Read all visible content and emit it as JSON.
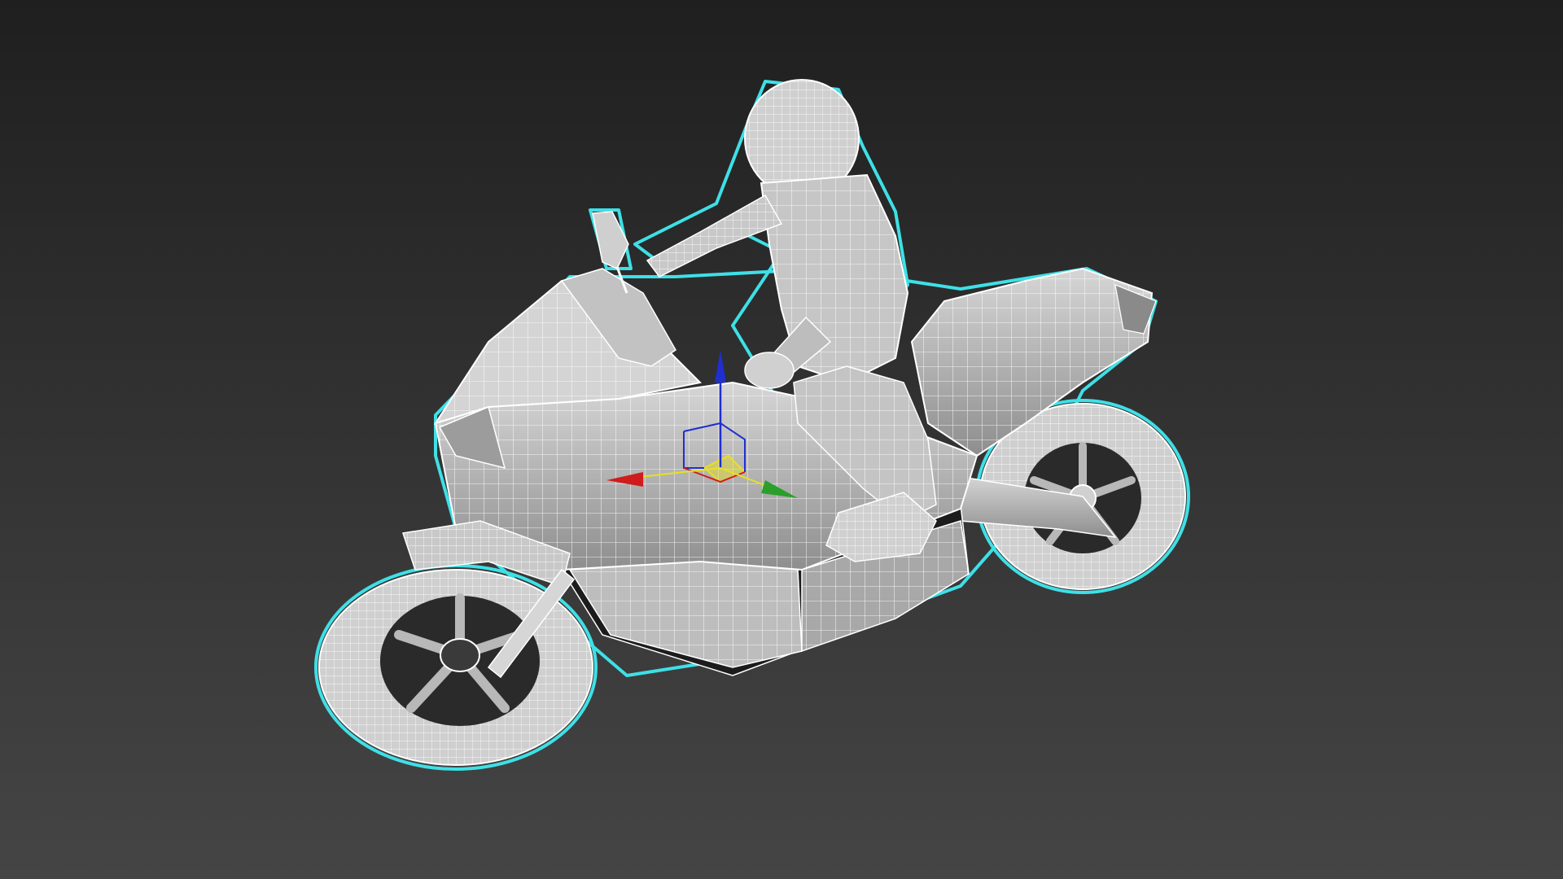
{
  "viewport": {
    "background_top": "#1f1f1f",
    "background_bottom": "#454545"
  },
  "model": {
    "fill": "#c8c8c8",
    "wire": "#ffffff",
    "shade": "#9a9a9a",
    "dark": "#1a1a1a",
    "selection_outline": "#3ee0e6"
  },
  "gizmo": {
    "x_axis_color": "#d01c1c",
    "y_axis_color": "#2aa02a",
    "z_axis_color": "#1f2fd0",
    "plane_color": "#e8e020"
  }
}
